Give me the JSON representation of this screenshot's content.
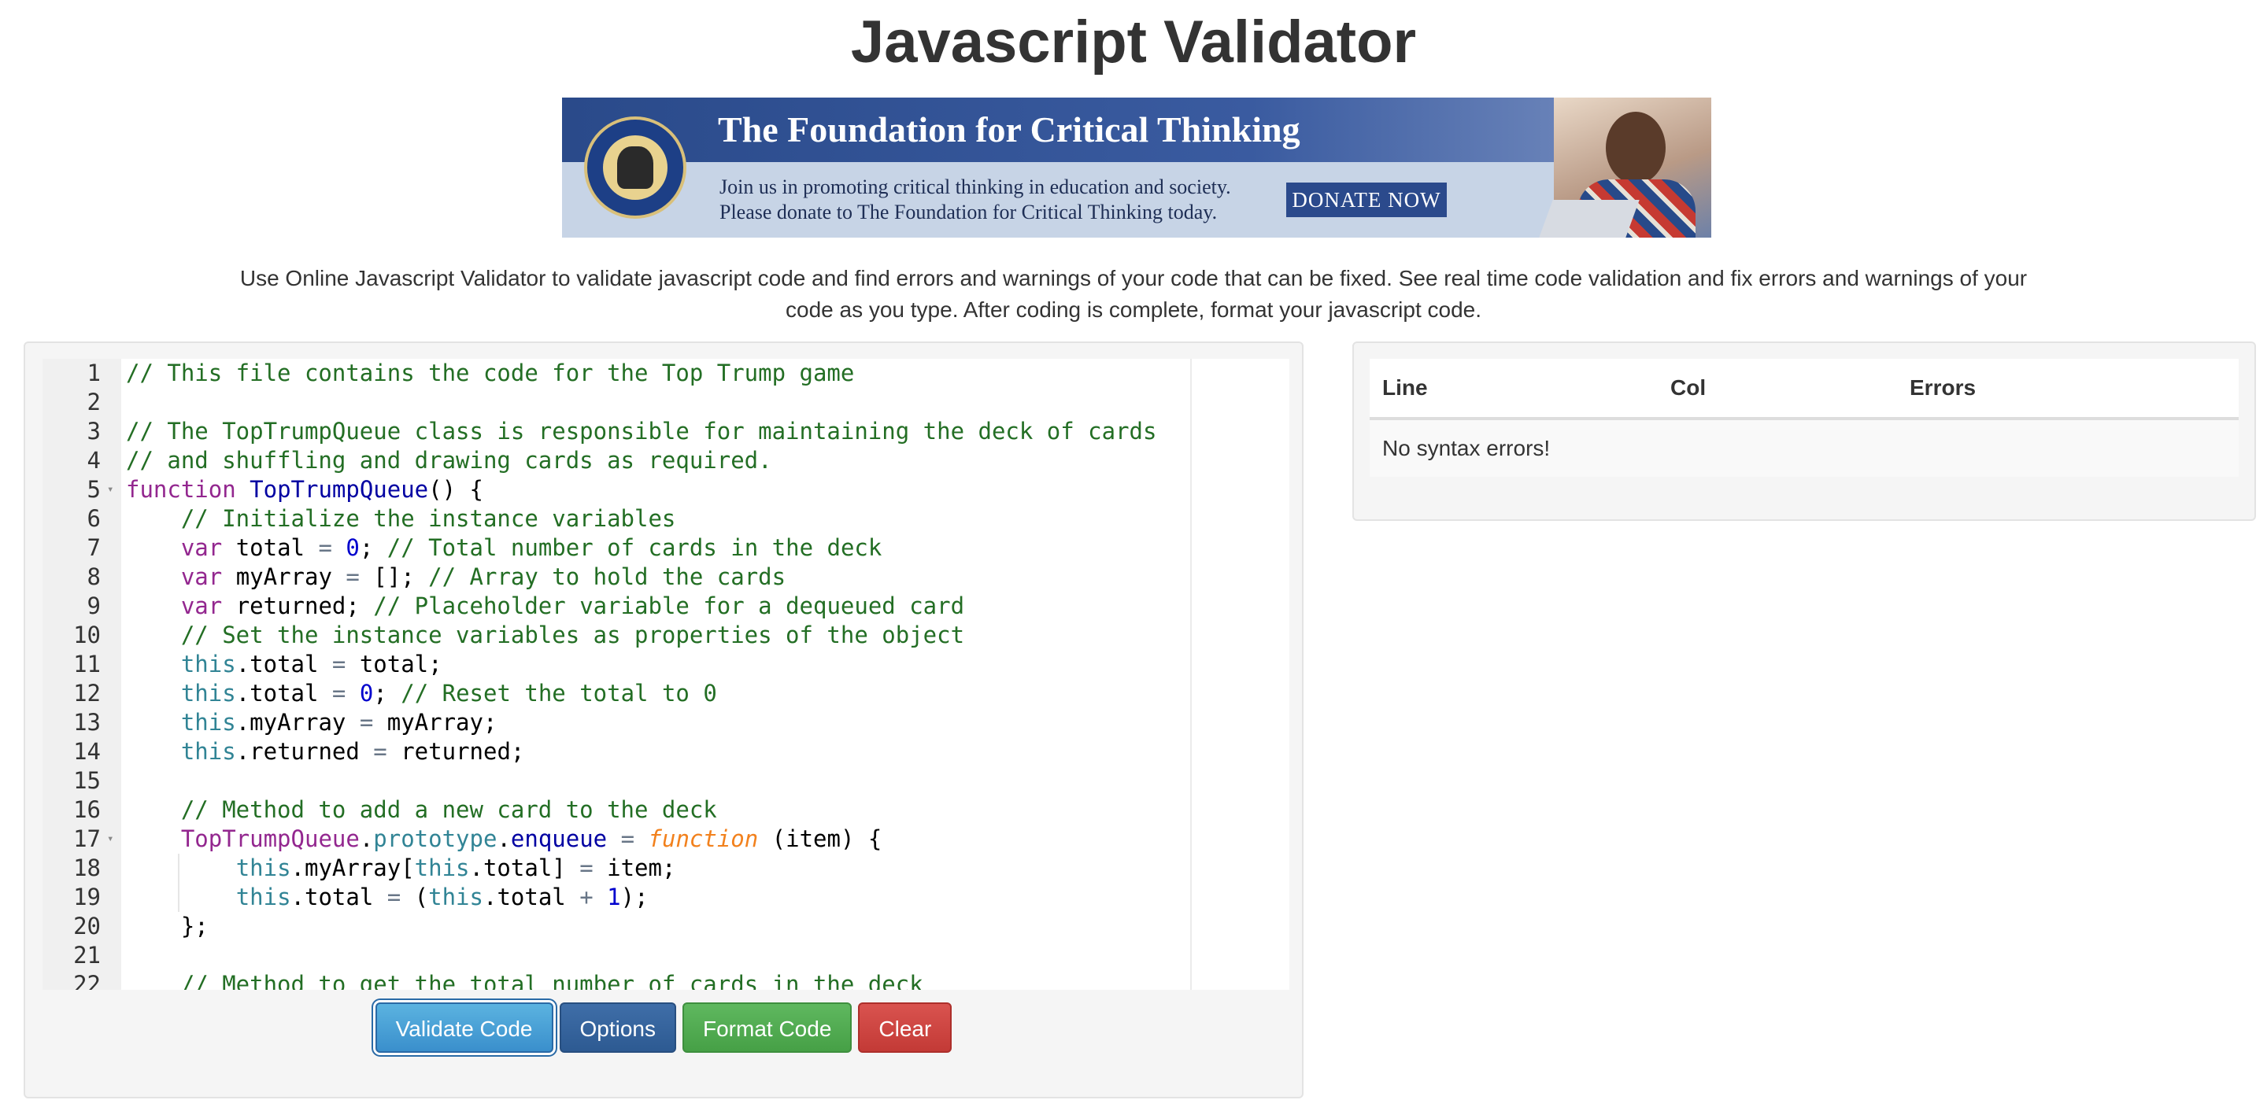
{
  "page": {
    "title": "Javascript Validator",
    "intro": "Use Online Javascript Validator to validate javascript code and find errors and warnings of your code that can be fixed. See real time code validation and fix errors and warnings of your code as you type. After coding is complete, format your javascript code."
  },
  "banner": {
    "heading": "The Foundation for Critical Thinking",
    "line1": "Join us in promoting critical thinking in education and society.",
    "line2": "Please donate to The Foundation for Critical Thinking today.",
    "donate_label": "DONATE NOW"
  },
  "editor": {
    "lines": [
      {
        "n": "1",
        "fold": ""
      },
      {
        "n": "2",
        "fold": ""
      },
      {
        "n": "3",
        "fold": ""
      },
      {
        "n": "4",
        "fold": ""
      },
      {
        "n": "5",
        "fold": "▾"
      },
      {
        "n": "6",
        "fold": ""
      },
      {
        "n": "7",
        "fold": ""
      },
      {
        "n": "8",
        "fold": ""
      },
      {
        "n": "9",
        "fold": ""
      },
      {
        "n": "10",
        "fold": ""
      },
      {
        "n": "11",
        "fold": ""
      },
      {
        "n": "12",
        "fold": ""
      },
      {
        "n": "13",
        "fold": ""
      },
      {
        "n": "14",
        "fold": ""
      },
      {
        "n": "15",
        "fold": ""
      },
      {
        "n": "16",
        "fold": ""
      },
      {
        "n": "17",
        "fold": "▾"
      },
      {
        "n": "18",
        "fold": ""
      },
      {
        "n": "19",
        "fold": ""
      },
      {
        "n": "20",
        "fold": ""
      },
      {
        "n": "21",
        "fold": ""
      },
      {
        "n": "22",
        "fold": ""
      }
    ],
    "code": {
      "l1": "// This file contains the code for the Top Trump game",
      "l3": "// The TopTrumpQueue class is responsible for maintaining the deck of cards",
      "l4": "// and shuffling and drawing cards as required.",
      "l5_kw": "function",
      "l5_name": "TopTrumpQueue",
      "l5_rest": "() {",
      "l6": "    // Initialize the instance variables",
      "l7_kw": "var",
      "l7_a": " total ",
      "l7_op": "=",
      "l7_num": "0",
      "l7_semi": "; ",
      "l7_comment": "// Total number of cards in the deck",
      "l8_kw": "var",
      "l8_a": " myArray ",
      "l8_op": "=",
      "l8_b": " []; ",
      "l8_comment": "// Array to hold the cards",
      "l9_kw": "var",
      "l9_a": " returned; ",
      "l9_comment": "// Placeholder variable for a dequeued card",
      "l10": "    // Set the instance variables as properties of the object",
      "l11_this": "this",
      "l11_a": ".total ",
      "l11_op": "=",
      "l11_b": " total;",
      "l12_this": "this",
      "l12_a": ".total ",
      "l12_op": "=",
      "l12_num": "0",
      "l12_semi": "; ",
      "l12_comment": "// Reset the total to 0",
      "l13_this": "this",
      "l13_a": ".myArray ",
      "l13_op": "=",
      "l13_b": " myArray;",
      "l14_this": "this",
      "l14_a": ".returned ",
      "l14_op": "=",
      "l14_b": " returned;",
      "l16": "    // Method to add a new card to the deck",
      "l17_class": "TopTrumpQueue",
      "l17_dot1": ".",
      "l17_proto": "prototype",
      "l17_dot2": ".",
      "l17_method": "enqueue",
      "l17_sp": " ",
      "l17_op": "=",
      "l17_sp2": " ",
      "l17_fn": "function",
      "l17_rest": " (item) {",
      "l18_this": "this",
      "l18_a": ".myArray[",
      "l18_this2": "this",
      "l18_b": ".total] ",
      "l18_op": "=",
      "l18_c": " item;",
      "l19_this": "this",
      "l19_a": ".total ",
      "l19_op": "=",
      "l19_b": " (",
      "l19_this2": "this",
      "l19_c": ".total ",
      "l19_op2": "+",
      "l19_sp": " ",
      "l19_num": "1",
      "l19_d": ");",
      "l20": "    };",
      "l22": "    // Method to get the total number of cards in the deck"
    }
  },
  "buttons": {
    "validate": "Validate Code",
    "options": "Options",
    "format": "Format Code",
    "clear": "Clear"
  },
  "results": {
    "headers": {
      "line": "Line",
      "col": "Col",
      "errors": "Errors"
    },
    "message": "No syntax errors!"
  }
}
